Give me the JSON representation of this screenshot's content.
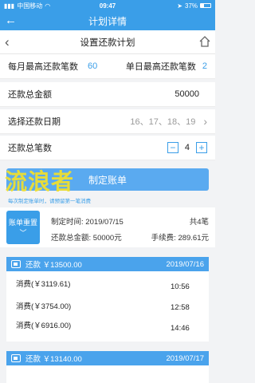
{
  "status": {
    "carrier": "中国移动",
    "time": "09:47",
    "battery": "37%"
  },
  "header": {
    "title": "计划详情"
  },
  "nav": {
    "title": "设置还款计划"
  },
  "form": {
    "monthly_label": "每月最高还款笔数",
    "monthly_value": "60",
    "daily_label": "单日最高还款笔数",
    "daily_value": "2",
    "total_label": "还款总金额",
    "total_value": "50000",
    "date_label": "选择还款日期",
    "date_value": "16、17、18、19",
    "count_label": "还款总笔数",
    "count_value": "4",
    "minus": "−",
    "plus": "+"
  },
  "create_button": "制定账单",
  "watermark": "流浪者",
  "notice": "每次制定账单时，请预留第一笔消费",
  "summary": {
    "reset_label": "账单重置",
    "made_time_label": "制定时间: ",
    "made_time": "2019/07/15",
    "count": "共4笔",
    "total_label": "还款总金额: ",
    "total": "50000元",
    "fee_label": "手续费: ",
    "fee": "289.61元"
  },
  "plans": [
    {
      "repay": "还款 ￥13500.00",
      "date": "2019/07/16",
      "items": [
        {
          "label": "消费(￥3119.61)",
          "time": "10:56"
        },
        {
          "label": "消费(￥3754.00)",
          "time": "12:58"
        },
        {
          "label": "消费(￥6916.00)",
          "time": "14:46"
        }
      ]
    },
    {
      "repay": "还款 ￥13140.00",
      "date": "2019/07/17"
    }
  ]
}
